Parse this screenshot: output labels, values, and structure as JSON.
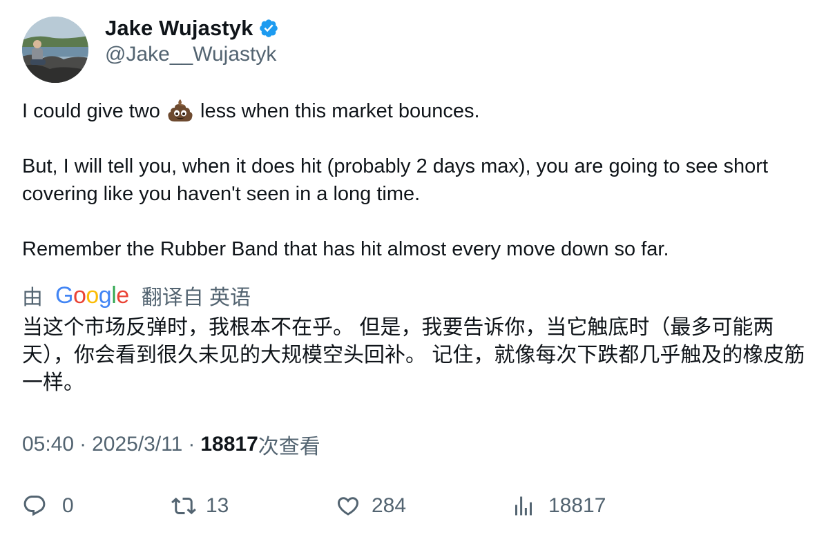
{
  "author": {
    "display_name": "Jake Wujastyk",
    "handle": "@Jake__Wujastyk",
    "verified": true,
    "verified_color": "#1d9bf0"
  },
  "tweet": {
    "line1_before": "I could give two ",
    "line1_emoji": "pile-of-poo-emoji",
    "line1_after": " less when this market bounces.",
    "paragraph2": "But, I will tell you, when it does hit (probably 2 days max), you are going to see short covering like you haven't seen in a long time.",
    "paragraph3": "Remember the Rubber Band that has hit almost every move down so far."
  },
  "translation": {
    "prefix": "由",
    "provider": "Google",
    "suffix": "翻译自 英语",
    "text": "当这个市场反弹时，我根本不在乎。 但是，我要告诉你，当它触底时（最多可能两天），你会看到很久未见的大规模空头回补。 记住，就像每次下跌都几乎触及的橡皮筋一样。"
  },
  "meta": {
    "time": "05:40",
    "separator": "·",
    "date": "2025/3/11",
    "views_count": "18817",
    "views_label": "次查看"
  },
  "actions": {
    "replies": "0",
    "retweets": "13",
    "likes": "284",
    "views": "18817"
  },
  "colors": {
    "text_primary": "#0f1419",
    "text_secondary": "#536471",
    "google_blue": "#4285f4",
    "google_red": "#ea4335",
    "google_yellow": "#fbbc05",
    "google_green": "#34a853"
  }
}
